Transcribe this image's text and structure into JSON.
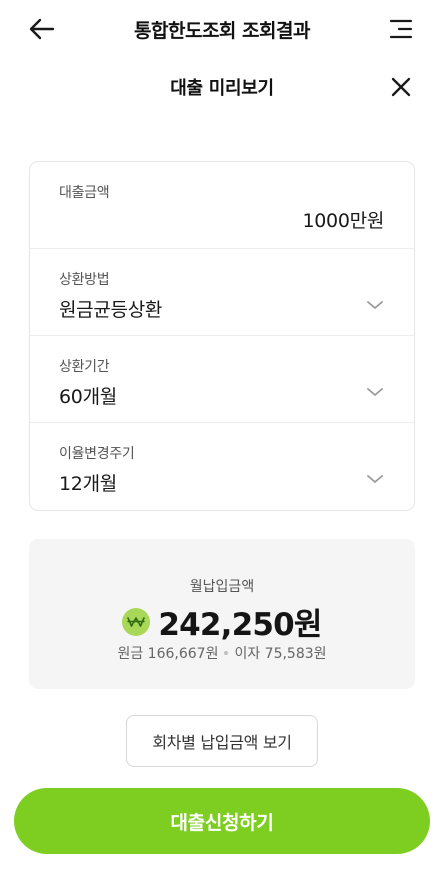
{
  "nav": {
    "title": "통합한도조회 조회결과",
    "back_icon": "back-arrow-icon",
    "menu_icon": "menu-icon"
  },
  "sheet": {
    "title": "대출 미리보기",
    "close_icon": "close-icon"
  },
  "form": {
    "amount": {
      "label": "대출금액",
      "value": "1000만원"
    },
    "method": {
      "label": "상환방법",
      "value": "원금균등상환"
    },
    "period": {
      "label": "상환기간",
      "value": "60개월"
    },
    "rate_cycle": {
      "label": "이율변경주기",
      "value": "12개월"
    }
  },
  "summary": {
    "label": "월납입금액",
    "amount": "242,250원",
    "principal": "원금 166,667원",
    "interest": "이자 75,583원"
  },
  "buttons": {
    "schedule": "회차별 납입금액 보기",
    "apply": "대출신청하기"
  },
  "colors": {
    "accent": "#7ece22",
    "icon_bg": "#a9d858",
    "summary_bg": "#f5f5f5"
  }
}
